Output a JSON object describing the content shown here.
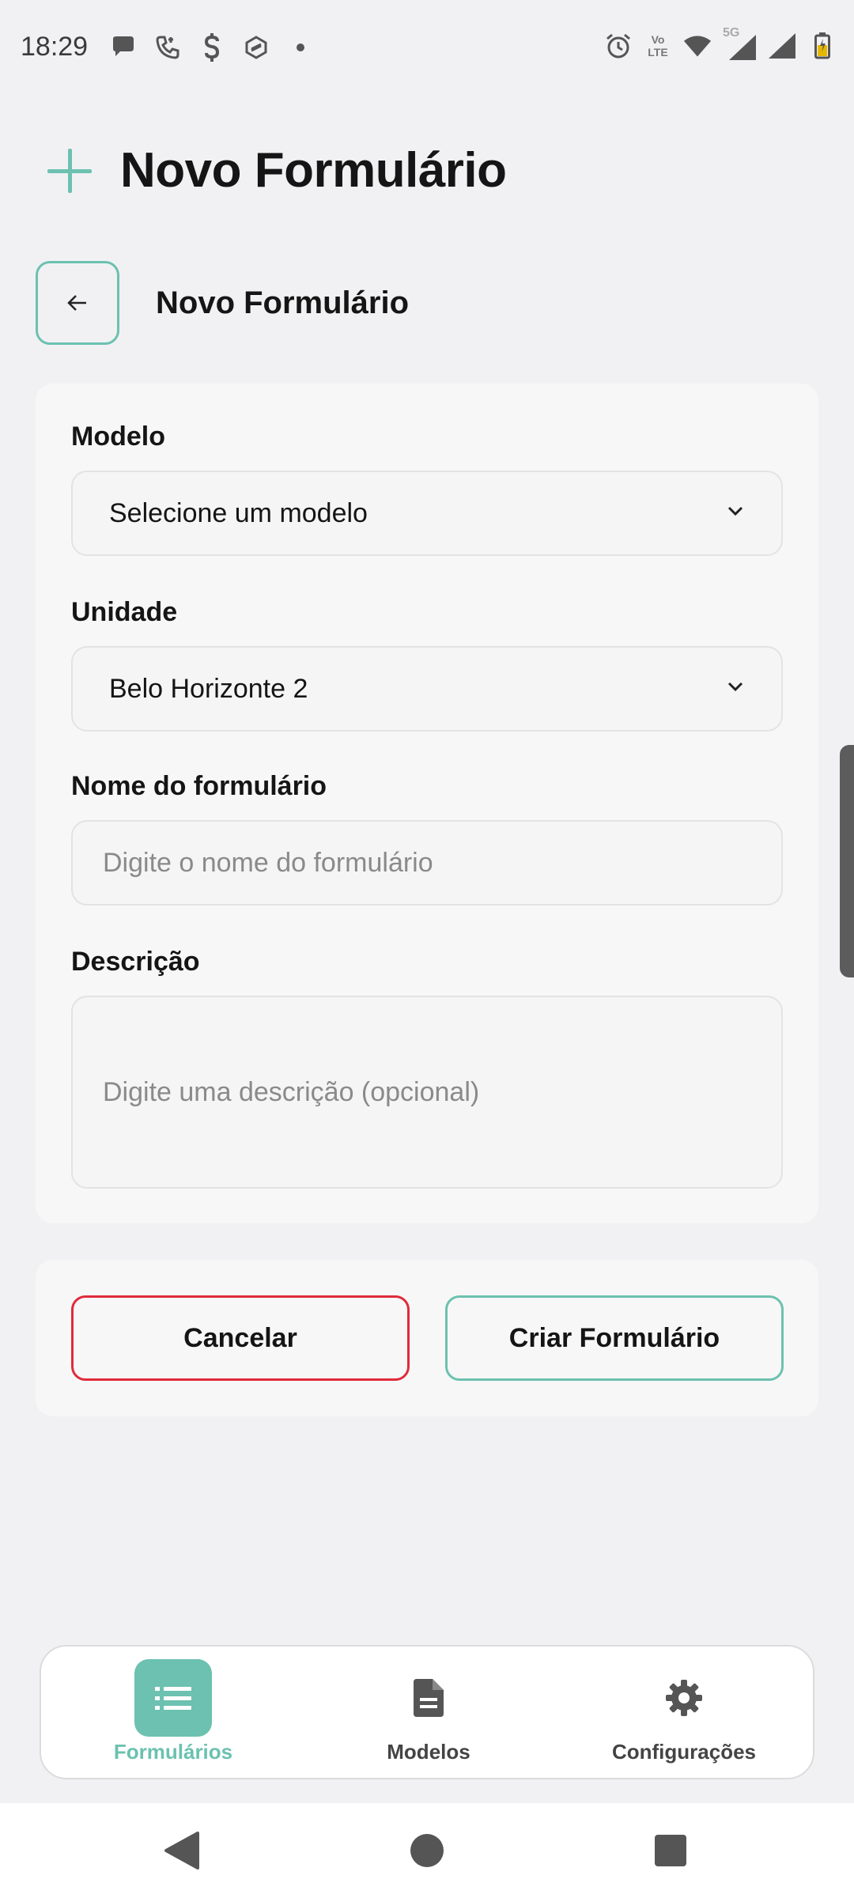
{
  "status_bar": {
    "time": "18:29",
    "left_icons": [
      "chat-icon",
      "phone-icon",
      "dollar-icon",
      "app-icon",
      "dot-icon"
    ],
    "right_icons": [
      "alarm-icon",
      "volte-icon",
      "wifi-icon",
      "signal-5g-icon",
      "signal-icon",
      "battery-icon"
    ],
    "volte_text": "Vo LTE",
    "network_label": "5G"
  },
  "header": {
    "title": "Novo Formulário",
    "icon": "plus-icon",
    "accent": "#6cc1b0"
  },
  "subheader": {
    "title": "Novo Formulário",
    "back_icon": "arrow-left-icon"
  },
  "form": {
    "model_label": "Modelo",
    "model_value": "Selecione um modelo",
    "unit_label": "Unidade",
    "unit_value": "Belo Horizonte 2",
    "name_label": "Nome do formulário",
    "name_placeholder": "Digite o nome do formulário",
    "description_label": "Descrição",
    "description_placeholder": "Digite uma descrição (opcional)"
  },
  "actions": {
    "cancel": "Cancelar",
    "create": "Criar Formulário",
    "cancel_color": "#e02b3a"
  },
  "bottom_nav": {
    "items": [
      {
        "label": "Formulários",
        "icon": "list-icon",
        "active": true
      },
      {
        "label": "Modelos",
        "icon": "document-icon",
        "active": false
      },
      {
        "label": "Configurações",
        "icon": "gear-icon",
        "active": false
      }
    ]
  },
  "system_nav": [
    "back-triangle-icon",
    "home-circle-icon",
    "recents-square-icon"
  ]
}
